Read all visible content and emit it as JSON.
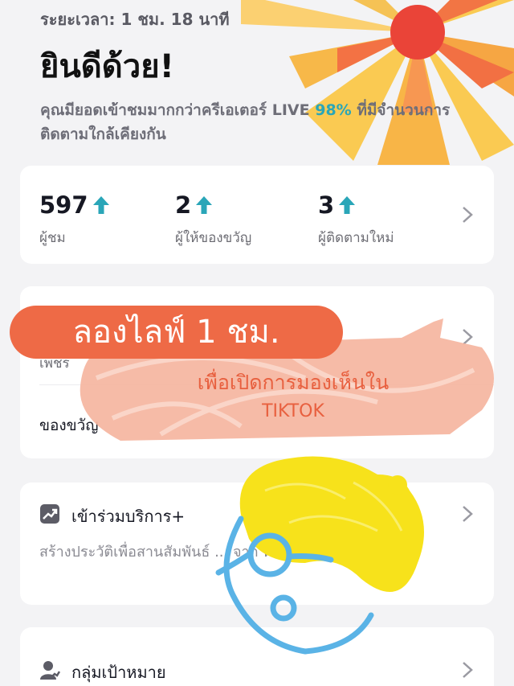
{
  "header": {
    "duration": "ระยะเวลา: 1 ชม. 18 นาที",
    "congrats": "ยินดีด้วย!",
    "summary_pre": "คุณมียอดเข้าชมมากกว่าครีเอเตอร์ LIVE ",
    "summary_pct": "98%",
    "summary_post": " ที่มีจำนวนการติดตามใกล้เคียงกัน"
  },
  "stats": [
    {
      "value": "597",
      "label": "ผู้ชม",
      "trend": "up-arrow-icon"
    },
    {
      "value": "2",
      "label": "ผู้ให้ของขวัญ",
      "trend": "up-arrow-icon"
    },
    {
      "value": "3",
      "label": "ผู้ติดตามใหม่",
      "trend": "up-arrow-icon"
    }
  ],
  "gifts": {
    "fragment": "เพชร",
    "label": "ของขวัญ"
  },
  "join": {
    "icon": "trend-chart-icon",
    "title": "เข้าร่วมบริการ+",
    "desc": "สร้างประวัติเพื่อสานสัมพันธ์ ... จาก ทักษะของคุณ!"
  },
  "target": {
    "icon": "audience-icon",
    "title": "กลุ่มเป้าหมาย"
  },
  "overlay": {
    "pill_text": "ลองไลฟ์ 1 ชม.",
    "bubble_line1": "เพื่อเปิดการมองเห็นใน",
    "bubble_line2": "TIKTOK"
  },
  "colors": {
    "accent_teal": "#2aa6b8",
    "pill_orange": "#ee6a46",
    "burst_yellow": "#fbc84a",
    "sticker_yellow": "#f7e21b",
    "sticker_blue": "#5ab3e6"
  }
}
